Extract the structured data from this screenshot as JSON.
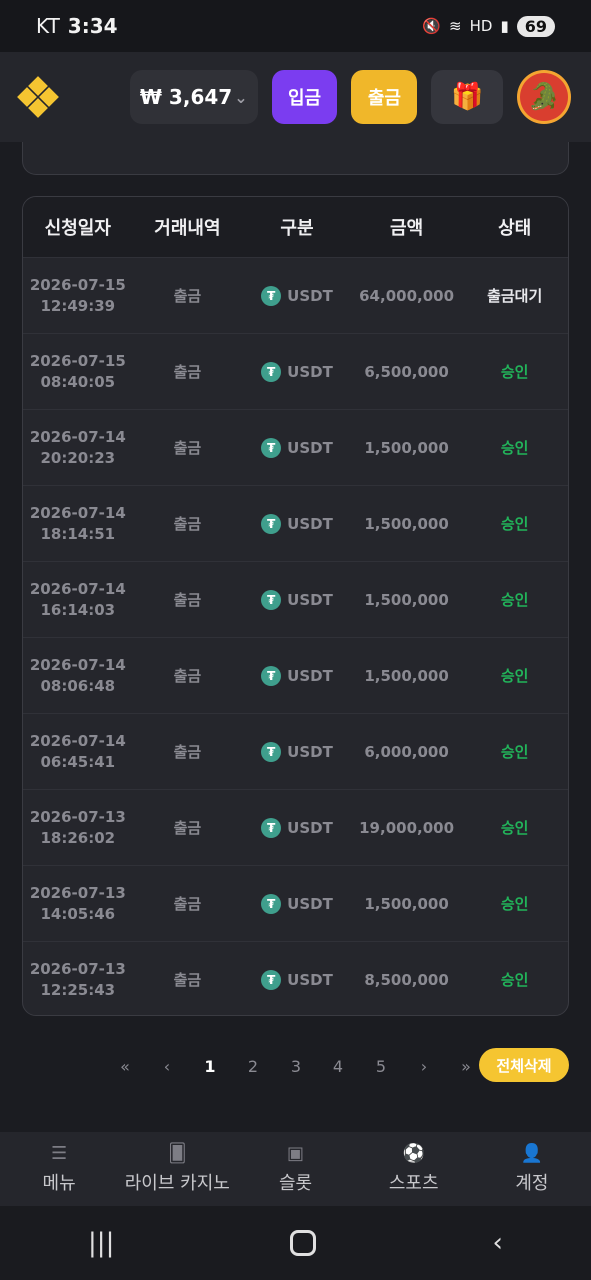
{
  "status_bar": {
    "carrier": "KT",
    "time": "3:34",
    "battery": "69",
    "icons": [
      "mute-icon",
      "wifi-icon",
      "hd-icon",
      "signal-icon"
    ]
  },
  "header": {
    "balance": "₩ 3,647",
    "deposit_label": "입금",
    "withdraw_label": "출금",
    "gift_icon": "gift-icon"
  },
  "table": {
    "headers": [
      "신청일자",
      "거래내역",
      "구분",
      "금액",
      "상태"
    ],
    "rows": [
      {
        "date": "2026-07-15",
        "time": "12:49:39",
        "type": "출금",
        "currency": "USDT",
        "amount": "64,000,000",
        "status": "출금대기",
        "status_kind": "pending"
      },
      {
        "date": "2026-07-15",
        "time": "08:40:05",
        "type": "출금",
        "currency": "USDT",
        "amount": "6,500,000",
        "status": "승인",
        "status_kind": "approved"
      },
      {
        "date": "2026-07-14",
        "time": "20:20:23",
        "type": "출금",
        "currency": "USDT",
        "amount": "1,500,000",
        "status": "승인",
        "status_kind": "approved"
      },
      {
        "date": "2026-07-14",
        "time": "18:14:51",
        "type": "출금",
        "currency": "USDT",
        "amount": "1,500,000",
        "status": "승인",
        "status_kind": "approved"
      },
      {
        "date": "2026-07-14",
        "time": "16:14:03",
        "type": "출금",
        "currency": "USDT",
        "amount": "1,500,000",
        "status": "승인",
        "status_kind": "approved"
      },
      {
        "date": "2026-07-14",
        "time": "08:06:48",
        "type": "출금",
        "currency": "USDT",
        "amount": "1,500,000",
        "status": "승인",
        "status_kind": "approved"
      },
      {
        "date": "2026-07-14",
        "time": "06:45:41",
        "type": "출금",
        "currency": "USDT",
        "amount": "6,000,000",
        "status": "승인",
        "status_kind": "approved"
      },
      {
        "date": "2026-07-13",
        "time": "18:26:02",
        "type": "출금",
        "currency": "USDT",
        "amount": "19,000,000",
        "status": "승인",
        "status_kind": "approved"
      },
      {
        "date": "2026-07-13",
        "time": "14:05:46",
        "type": "출금",
        "currency": "USDT",
        "amount": "1,500,000",
        "status": "승인",
        "status_kind": "approved"
      },
      {
        "date": "2026-07-13",
        "time": "12:25:43",
        "type": "출금",
        "currency": "USDT",
        "amount": "8,500,000",
        "status": "승인",
        "status_kind": "approved"
      }
    ]
  },
  "pagination": {
    "first": "«",
    "prev": "‹",
    "pages": [
      "1",
      "2",
      "3",
      "4",
      "5"
    ],
    "active": "1",
    "next": "›",
    "last": "»",
    "delete_all": "전체삭제"
  },
  "bottom_nav": [
    {
      "label": "메뉴",
      "icon": "menu-icon"
    },
    {
      "label": "라이브 카지노",
      "icon": "cards-icon"
    },
    {
      "label": "슬롯",
      "icon": "slot-icon"
    },
    {
      "label": "스포츠",
      "icon": "ball-icon"
    },
    {
      "label": "계정",
      "icon": "user-icon"
    }
  ],
  "colors": {
    "approved": "#22b35a",
    "deposit": "#7b3df0",
    "withdraw": "#f0b72a",
    "accent": "#f5c531"
  }
}
